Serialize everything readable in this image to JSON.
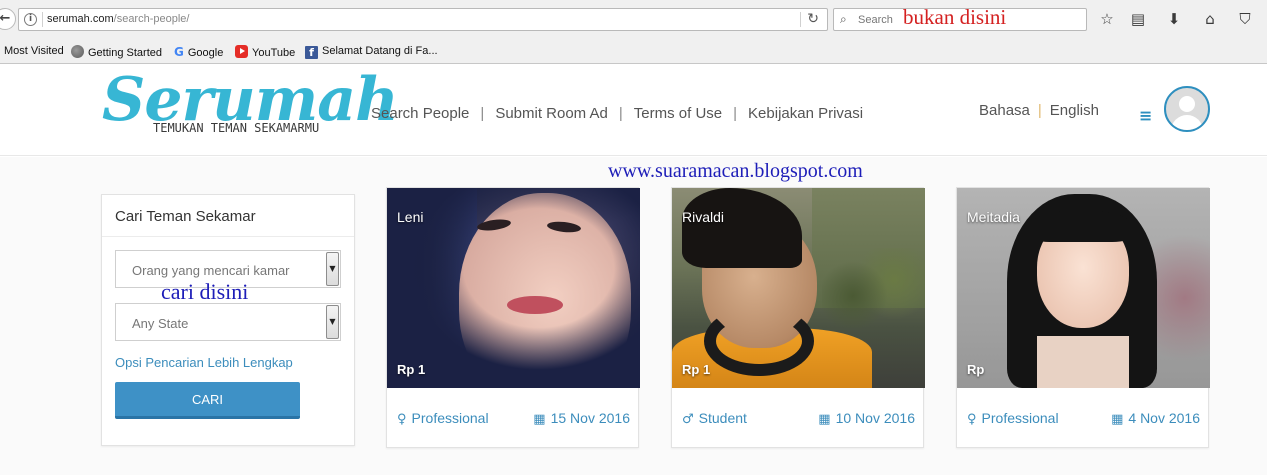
{
  "browser": {
    "back_glyph": "←",
    "info_glyph": "i",
    "url_domain": "serumah.com",
    "url_path": "/search-people/",
    "reload_glyph": "↻",
    "search_glyph": "⌕",
    "search_placeholder": "Search",
    "annotation_top": "bukan disini",
    "toolbar_icons": [
      {
        "name": "bookmark-star-icon",
        "glyph": "☆"
      },
      {
        "name": "reading-list-icon",
        "glyph": "▤"
      },
      {
        "name": "download-icon",
        "glyph": "⬇"
      },
      {
        "name": "home-icon",
        "glyph": "⌂"
      },
      {
        "name": "pocket-icon",
        "glyph": "⛉"
      }
    ]
  },
  "bookmarks": [
    {
      "label": "Most Visited",
      "icon": "none"
    },
    {
      "label": "Getting Started",
      "icon": "globe-icon"
    },
    {
      "label": "Google",
      "icon": "google-icon"
    },
    {
      "label": "YouTube",
      "icon": "youtube-icon"
    },
    {
      "label": "Selamat Datang di Fa...",
      "icon": "facebook-icon"
    }
  ],
  "header": {
    "logo_word": "Serumah",
    "logo_tagline": "TEMUKAN TEMAN SEKAMARMU",
    "nav": [
      "Search People",
      "Submit Room Ad",
      "Terms of Use",
      "Kebijakan Privasi"
    ],
    "nav_separator": "|",
    "lang_label": "Bahasa",
    "lang_separator": "|",
    "lang_value": "English",
    "menu_glyph": "≡"
  },
  "watermark": "www.suaramacan.blogspot.com",
  "search_panel": {
    "title": "Cari Teman Sekamar",
    "type_select": "Orang yang mencari kamar",
    "state_select": "Any State",
    "select_arrow": "▼",
    "annotation": "cari disini",
    "advanced_link": "Opsi Pencarian Lebih Lengkap",
    "button": "CARI"
  },
  "cards": [
    {
      "name": "Leni",
      "price": "Rp 1",
      "gender_glyph": "♀",
      "occupation": "Professional",
      "calendar_glyph": "▦",
      "date": "15 Nov 2016"
    },
    {
      "name": "Rivaldi",
      "price": "Rp 1",
      "gender_glyph": "♂",
      "occupation": "Student",
      "calendar_glyph": "▦",
      "date": "10 Nov 2016"
    },
    {
      "name": "Meitadia",
      "price": "Rp",
      "gender_glyph": "♀",
      "occupation": "Professional",
      "calendar_glyph": "▦",
      "date": "4 Nov 2016"
    }
  ],
  "colors": {
    "brand": "#37b6d4",
    "link": "#3c8dbc",
    "button": "#3e91c6",
    "annotation_red": "#d42020",
    "annotation_blue": "#1d1db8"
  }
}
